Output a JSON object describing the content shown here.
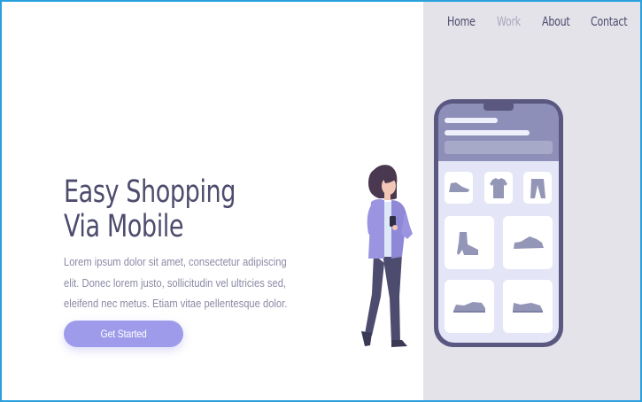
{
  "nav": {
    "items": [
      {
        "label": "Home",
        "active": false
      },
      {
        "label": "Work",
        "active": true
      },
      {
        "label": "About",
        "active": false
      },
      {
        "label": "Contact",
        "active": false
      }
    ]
  },
  "hero": {
    "title_line1": "Easy Shopping",
    "title_line2": "Via Mobile",
    "body_lines": [
      "Lorem ipsum dolor sit amet, consectetur  adipiscing",
      "elit. Donec lorem justo, sollicitudin vel ultricies sed,",
      "eleifend nec metus. Etiam vitae pellentesque dolor."
    ],
    "cta_label": "Get Started"
  },
  "phone": {
    "products": [
      "sneaker-icon",
      "tshirt-icon",
      "pants-icon",
      "boot-icon",
      "running-shoe-icon",
      "flat-shoe-icon",
      "loafer-icon"
    ]
  },
  "colors": {
    "accent": "#9e9cea",
    "text_dark": "#4d4c6e",
    "text_muted": "#8b8aa5",
    "panel_bg": "#e4e3ea",
    "phone_frame": "#5a5880",
    "frame_border": "#2aa0dd"
  }
}
